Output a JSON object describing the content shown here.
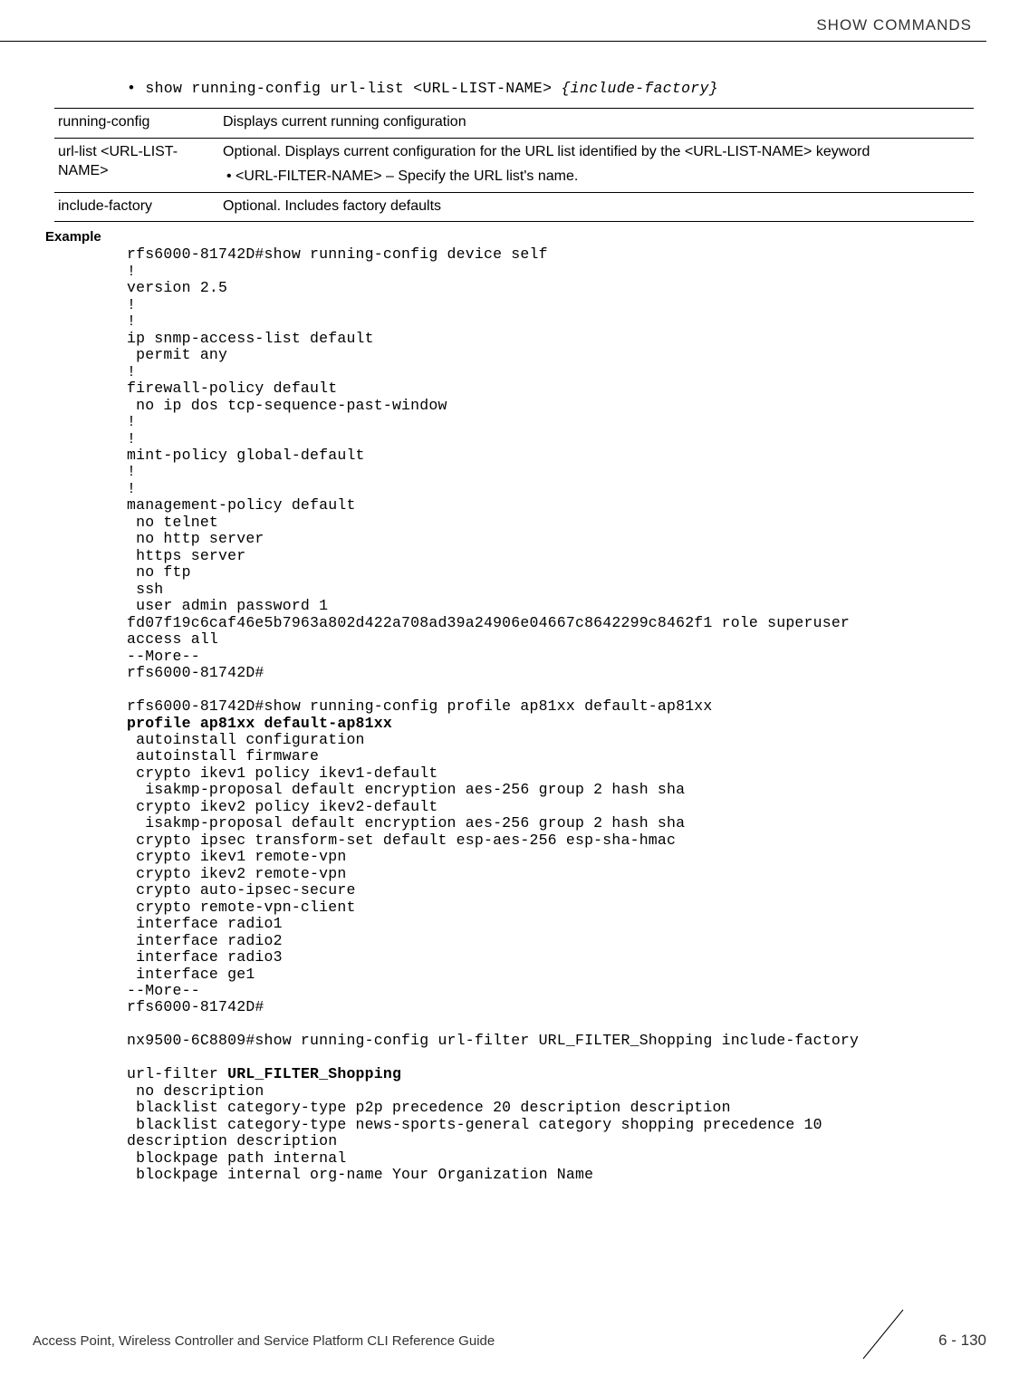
{
  "header": {
    "section": "SHOW COMMANDS"
  },
  "syntax": {
    "bullet": "•",
    "prefix": "show running-config url-list <URL-LIST-NAME> ",
    "italic": "{include-factory}"
  },
  "table": {
    "rows": [
      {
        "param": "running-config",
        "desc": "Displays current running configuration"
      },
      {
        "param": "url-list <URL-LIST-NAME>",
        "desc": "Optional. Displays current configuration for the URL list identified by the <URL-LIST-NAME> keyword",
        "sub": "•  <URL-FILTER-NAME> – Specify the URL list's name."
      },
      {
        "param": "include-factory",
        "desc": "Optional. Includes factory defaults"
      }
    ]
  },
  "example": {
    "label": "Example",
    "block1_pre": "rfs6000-81742D#show running-config device self\n!\nversion 2.5\n!\n!\nip snmp-access-list default\n permit any\n!\nfirewall-policy default\n no ip dos tcp-sequence-past-window\n!\n!\nmint-policy global-default\n!\n!\nmanagement-policy default\n no telnet\n no http server\n https server\n no ftp\n ssh\n user admin password 1 \nfd07f19c6caf46e5b7963a802d422a708ad39a24906e04667c8642299c8462f1 role superuser \naccess all\n--More--\nrfs6000-81742D#\n\nrfs6000-81742D#show running-config profile ap81xx default-ap81xx",
    "bold_line": "profile ap81xx default-ap81xx",
    "block1_post": " autoinstall configuration\n autoinstall firmware\n crypto ikev1 policy ikev1-default\n  isakmp-proposal default encryption aes-256 group 2 hash sha\n crypto ikev2 policy ikev2-default\n  isakmp-proposal default encryption aes-256 group 2 hash sha\n crypto ipsec transform-set default esp-aes-256 esp-sha-hmac\n crypto ikev1 remote-vpn\n crypto ikev2 remote-vpn\n crypto auto-ipsec-secure\n crypto remote-vpn-client\n interface radio1\n interface radio2\n interface radio3\n interface ge1\n--More--\nrfs6000-81742D#\n\nnx9500-6C8809#show running-config url-filter URL_FILTER_Shopping include-factory\n",
    "url_prefix": "url-filter ",
    "url_bold": "URL_FILTER_Shopping",
    "block2": " no description\n blacklist category-type p2p precedence 20 description description\n blacklist category-type news-sports-general category shopping precedence 10 \ndescription description\n blockpage path internal\n blockpage internal org-name Your Organization Name"
  },
  "footer": {
    "guide": "Access Point, Wireless Controller and Service Platform CLI Reference Guide",
    "page": "6 - 130"
  }
}
